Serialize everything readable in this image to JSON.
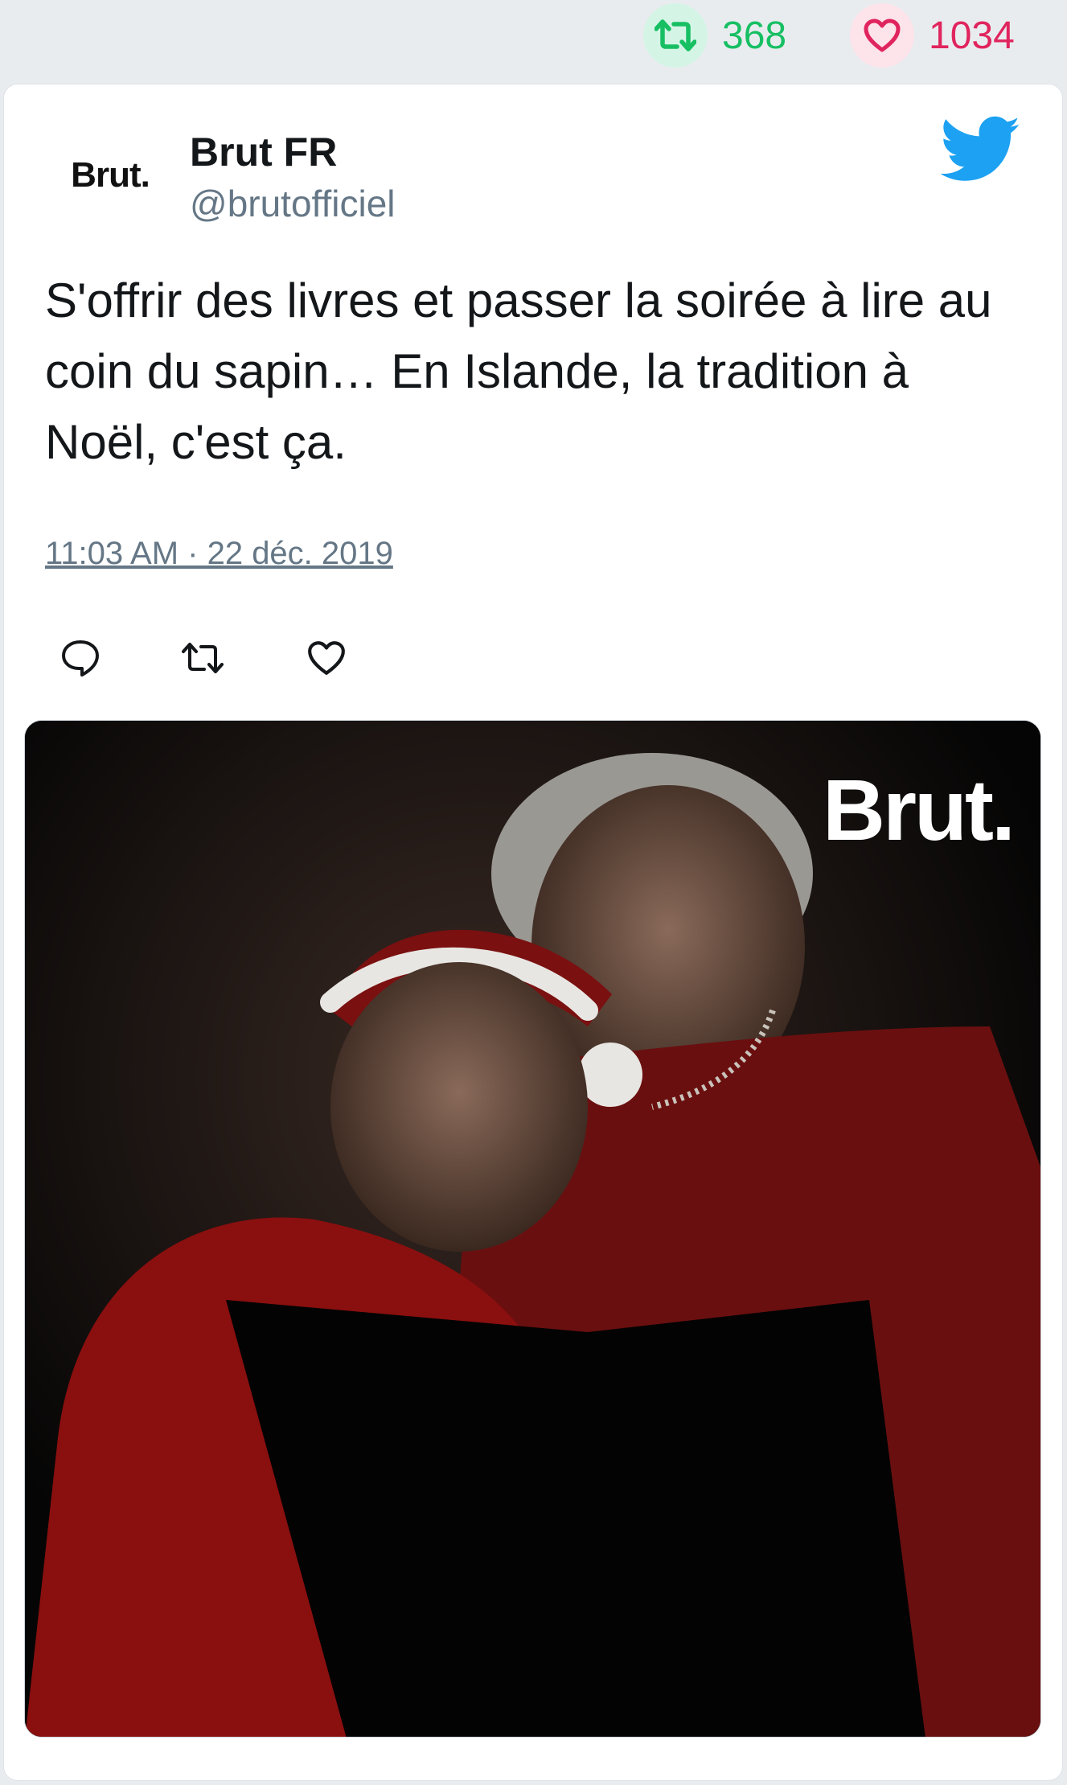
{
  "stats": {
    "retweet_count": "368",
    "like_count": "1034",
    "retweet_icon": "retweet-icon",
    "like_icon": "heart-icon",
    "retweet_color": "#17bf63",
    "like_color": "#e0245e"
  },
  "tweet": {
    "avatar_text": "Brut.",
    "display_name": "Brut FR",
    "handle": "@brutofficiel",
    "text": "S'offrir des livres et passer la soirée à lire au coin du sapin… En Islande, la tradition à Noël, c'est ça.",
    "timestamp": "11:03 AM · 22 déc. 2019",
    "brand_icon": "twitter-bird-icon",
    "brand_color": "#1da1f2",
    "actions": {
      "reply_icon": "reply-icon",
      "retweet_icon": "retweet-icon",
      "like_icon": "heart-icon"
    },
    "media": {
      "watermark": "Brut.",
      "description_icon": "photo-image"
    }
  }
}
